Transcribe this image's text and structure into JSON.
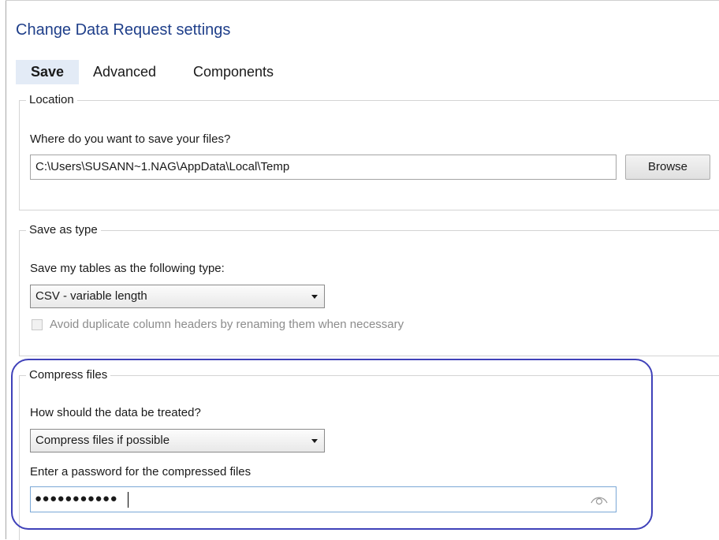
{
  "dialog": {
    "title": "Change Data Request settings"
  },
  "tabs": [
    {
      "label": "Save",
      "active": true
    },
    {
      "label": "Advanced",
      "active": false
    },
    {
      "label": "Components",
      "active": false
    }
  ],
  "location": {
    "legend": "Location",
    "prompt": "Where do you want to save your files?",
    "path_value": "C:\\Users\\SUSANN~1.NAG\\AppData\\Local\\Temp",
    "browse_label": "Browse"
  },
  "save_type": {
    "legend": "Save as type",
    "prompt": "Save my tables as the following type:",
    "selected": "CSV - variable length",
    "avoid_duplicates_label": "Avoid duplicate column headers by renaming them when necessary",
    "avoid_duplicates_checked": false
  },
  "compress": {
    "legend": "Compress files",
    "prompt": "How should the data be treated?",
    "selected": "Compress files if possible",
    "password_prompt": "Enter a password for the compressed files",
    "password_mask": "●●●●●●●●●●●"
  },
  "icons": {
    "caret": "chevron-down-icon",
    "reveal": "eye-icon"
  },
  "colors": {
    "title": "#1f3f8a",
    "active_tab_bg": "#e3ebf6",
    "highlight": "#3f41b9",
    "focus_border": "#7aa7d6"
  }
}
